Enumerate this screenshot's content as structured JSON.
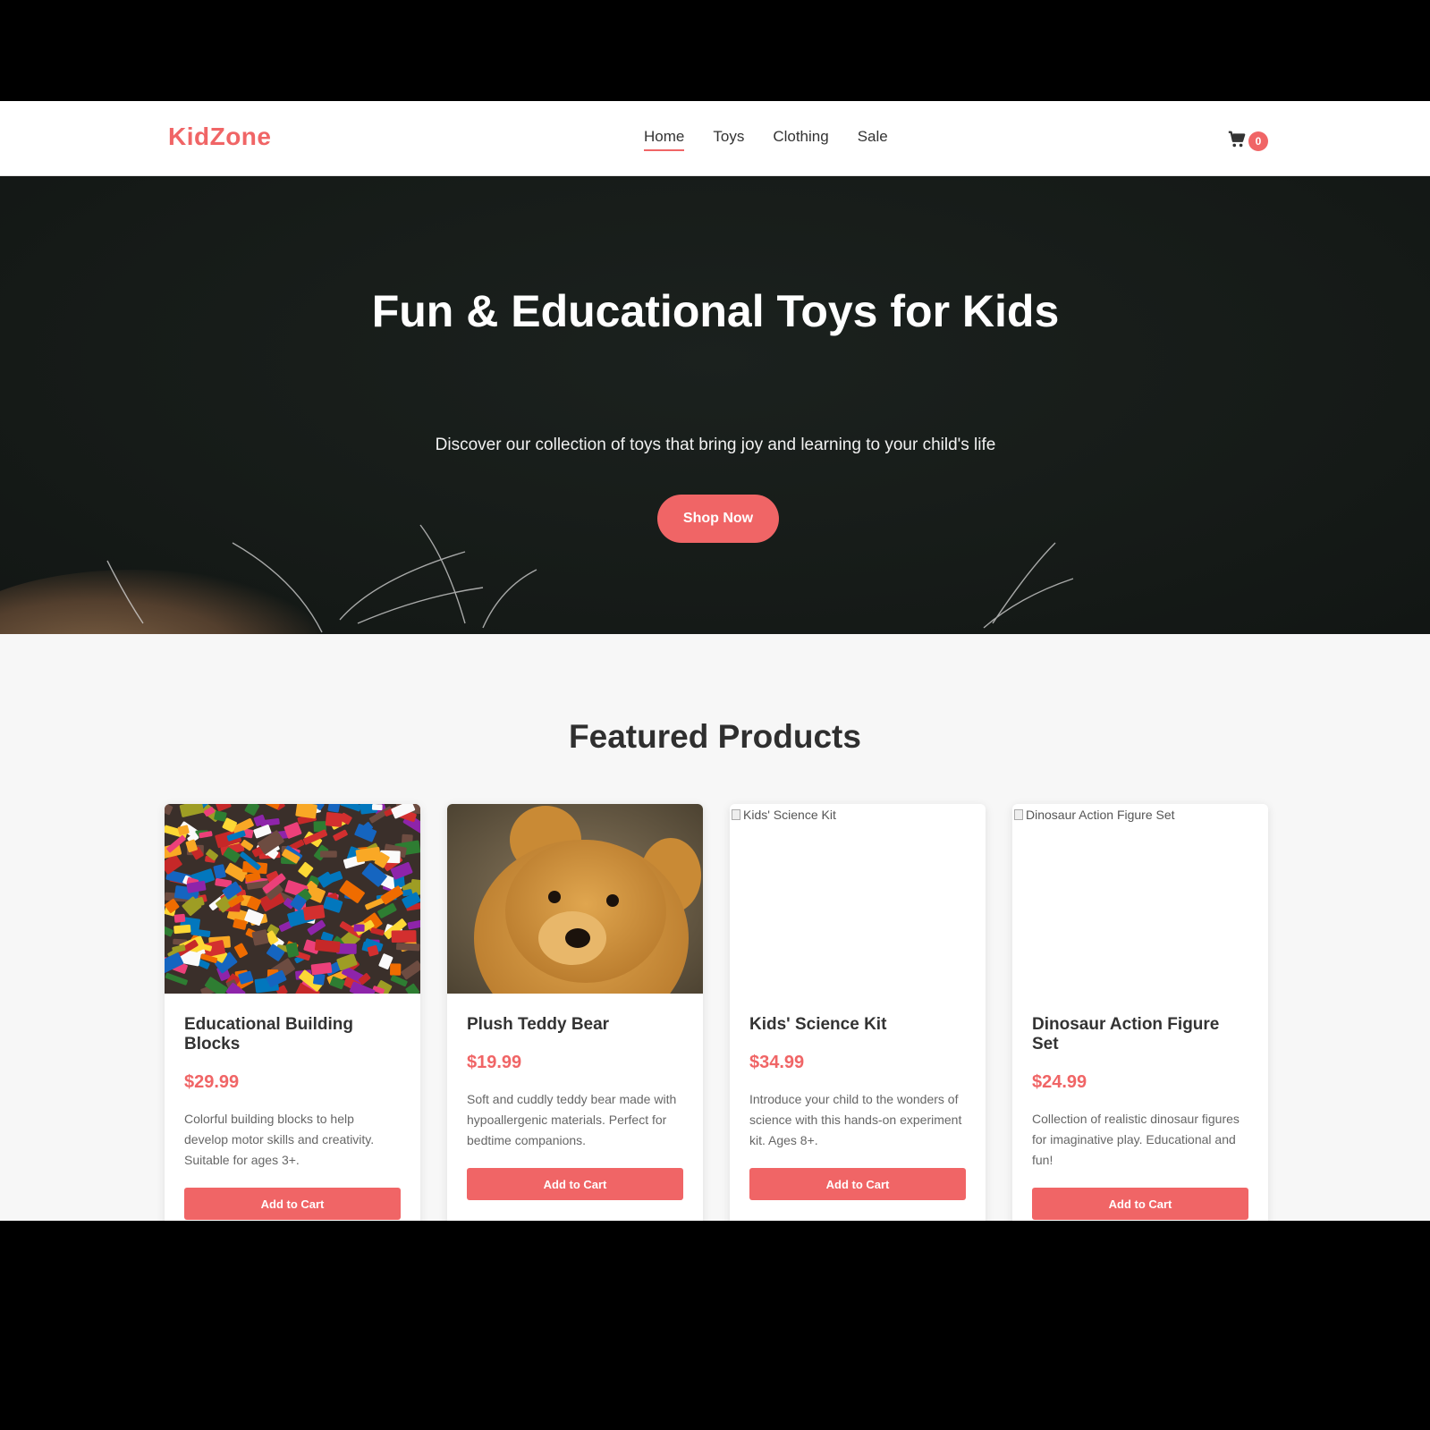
{
  "brand": {
    "name": "KidZone",
    "accent": "#f06566"
  },
  "nav": {
    "items": [
      "Home",
      "Toys",
      "Clothing",
      "Sale"
    ],
    "active": "Home"
  },
  "cart": {
    "icon": "cart-icon",
    "count": "0"
  },
  "hero": {
    "title": "Fun & Educational Toys for Kids",
    "subtitle": "Discover our collection of toys that bring joy and learning to your child's life",
    "cta_label": "Shop Now"
  },
  "featured": {
    "title": "Featured Products",
    "products": [
      {
        "name": "Educational Building Blocks",
        "price": "$29.99",
        "description": "Colorful building blocks to help develop motor skills and creativity. Suitable for ages 3+.",
        "image": "building-blocks-photo",
        "button_label": "Add to Cart"
      },
      {
        "name": "Plush Teddy Bear",
        "price": "$19.99",
        "description": "Soft and cuddly teddy bear made with hypoallergenic materials. Perfect for bedtime companions.",
        "image": "teddy-bear-photo",
        "button_label": "Add to Cart"
      },
      {
        "name": "Kids' Science Kit",
        "price": "$34.99",
        "description": "Introduce your child to the wonders of science with this hands-on experiment kit. Ages 8+.",
        "image_alt": "Kids' Science Kit",
        "button_label": "Add to Cart"
      },
      {
        "name": "Dinosaur Action Figure Set",
        "price": "$24.99",
        "description": "Collection of realistic dinosaur figures for imaginative play. Educational and fun!",
        "image_alt": "Dinosaur Action Figure Set",
        "button_label": "Add to Cart"
      }
    ]
  }
}
